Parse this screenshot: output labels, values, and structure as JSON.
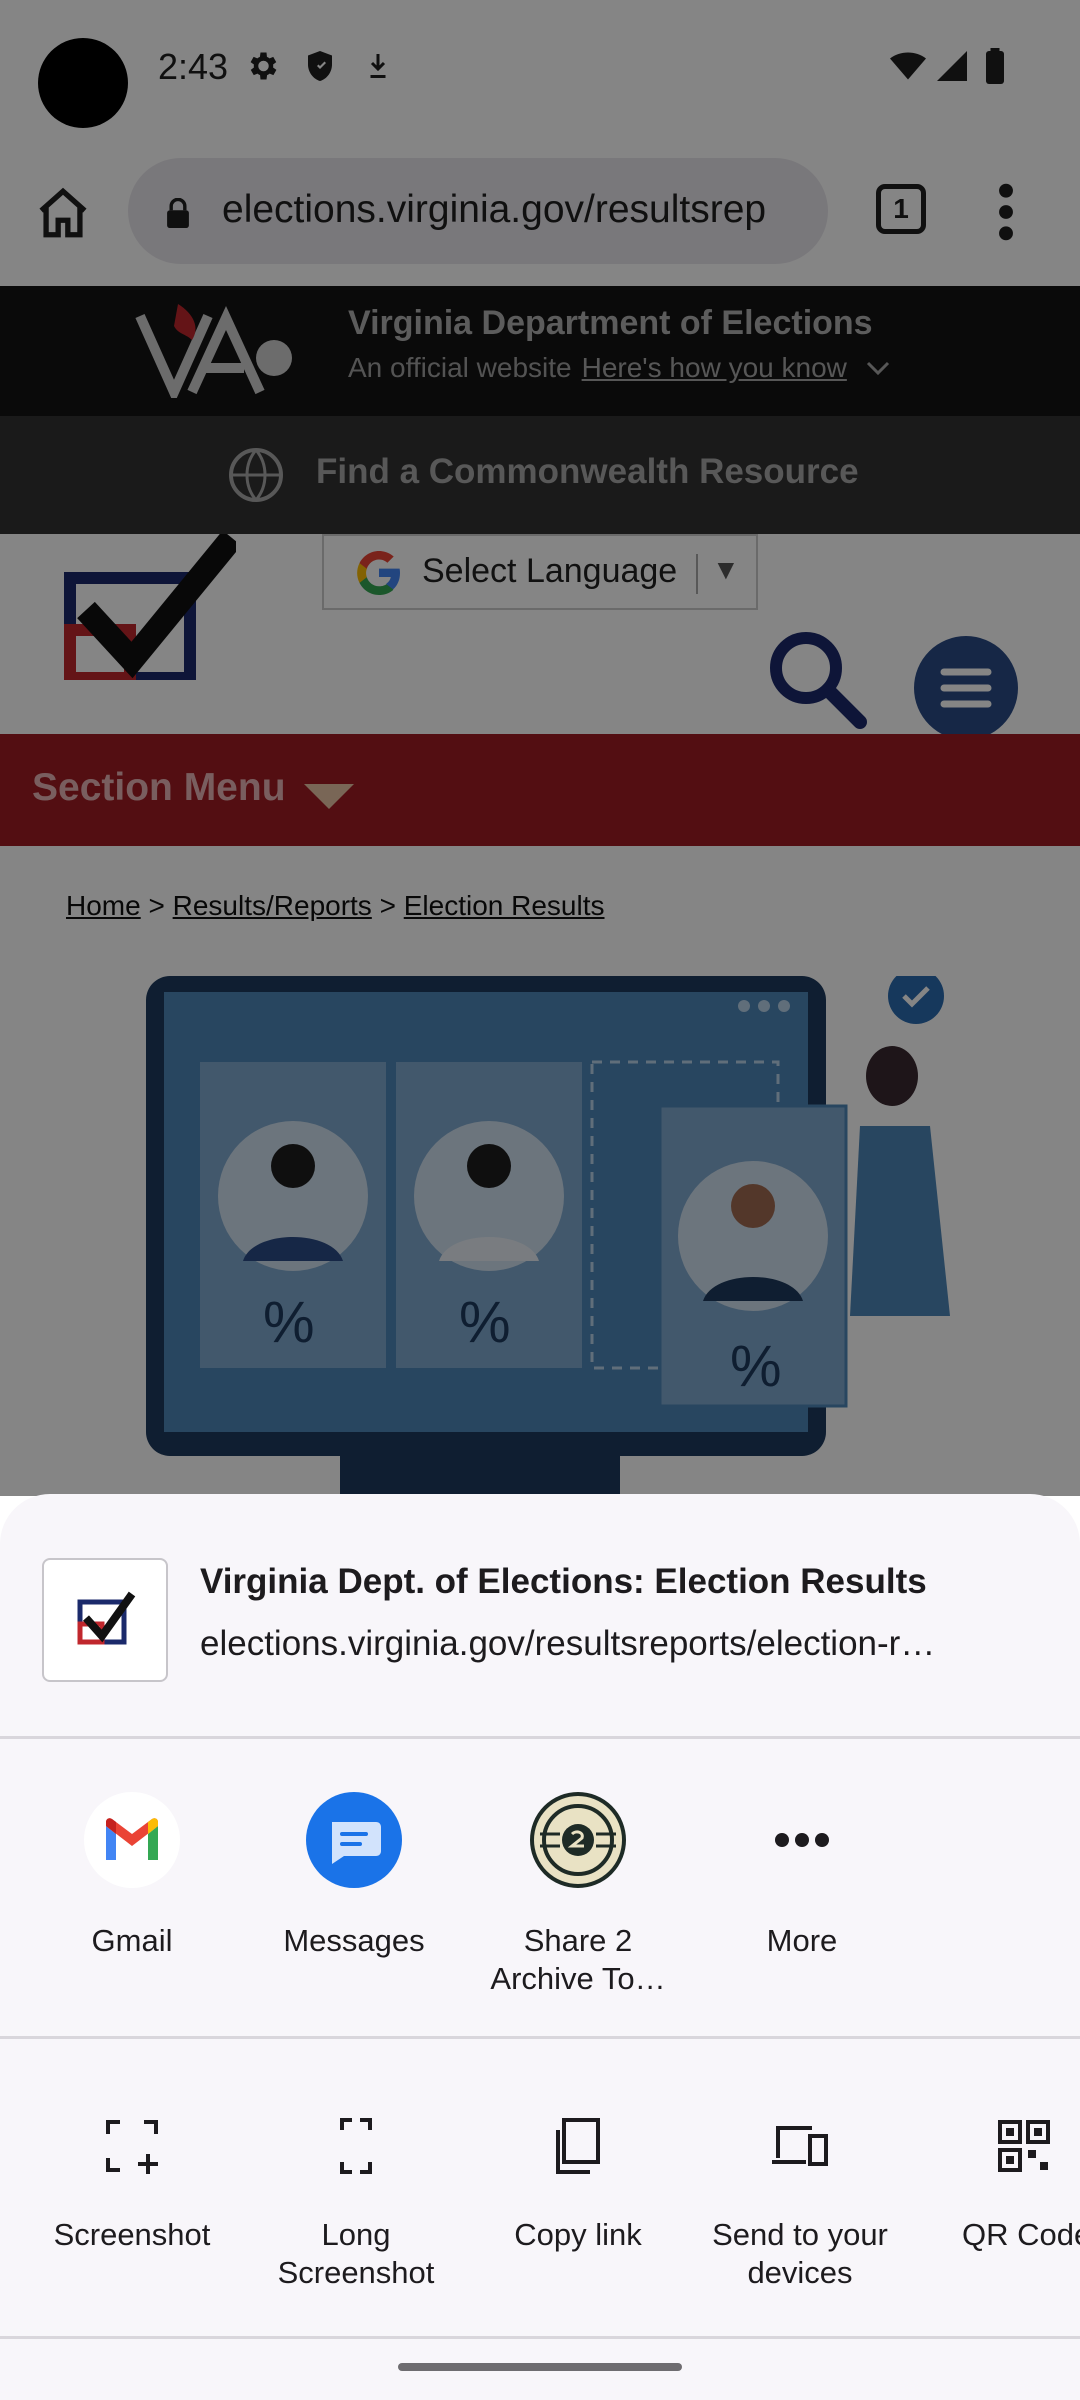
{
  "status_bar": {
    "time": "2:43",
    "icons": [
      "gear-icon",
      "shield-icon",
      "download-icon",
      "wifi-icon",
      "signal-icon",
      "battery-icon"
    ]
  },
  "browser": {
    "url": "elections.virginia.gov/resultsrep",
    "tab_count": "1"
  },
  "page": {
    "gov_title": "Virginia Department of Elections",
    "gov_sub": "An official website",
    "gov_link": "Here's how you know",
    "resource_link": "Find a Commonwealth Resource",
    "language_select": "Select Language",
    "language_arrow": "▼",
    "section_menu": "Section Menu",
    "breadcrumbs": [
      "Home",
      "Results/Reports",
      "Election Results"
    ],
    "breadcrumb_sep": ">",
    "poster_percent": "%"
  },
  "share_sheet": {
    "title": "Virginia Dept. of Elections: Election Results",
    "url": "elections.virginia.gov/resultsreports/election-r…",
    "apps": [
      {
        "label": "Gmail",
        "icon": "gmail-icon"
      },
      {
        "label": "Messages",
        "icon": "messages-icon"
      },
      {
        "label": "Share 2\nArchive To…",
        "icon": "share2archive-icon"
      },
      {
        "label": "More",
        "icon": "more-icon"
      }
    ],
    "actions": [
      {
        "label": "Screenshot",
        "icon": "screenshot-icon"
      },
      {
        "label": "Long\nScreenshot",
        "icon": "long-screenshot-icon"
      },
      {
        "label": "Copy link",
        "icon": "copy-icon"
      },
      {
        "label": "Send to your\ndevices",
        "icon": "devices-icon"
      },
      {
        "label": "QR Code",
        "icon": "qr-code-icon"
      }
    ]
  },
  "colors": {
    "section_menu": "#a01b24",
    "header_blue": "#2b4c86",
    "sheet_bg": "#f8f6fa",
    "messages_blue": "#1a73e8"
  }
}
